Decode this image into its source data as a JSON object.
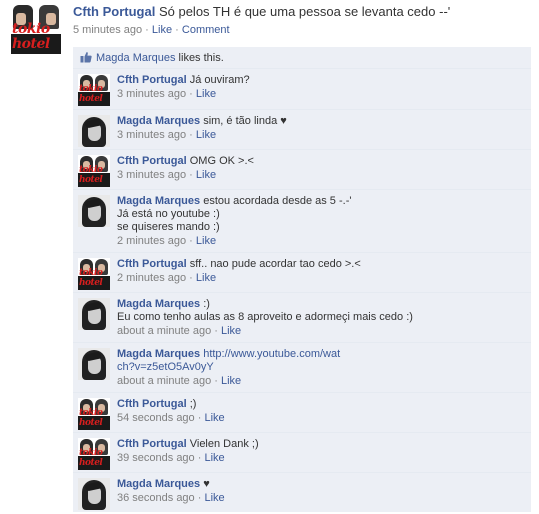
{
  "story": {
    "author": "Cfth Portugal",
    "message": "Só pelos TH é que uma pessoa se levanta cedo --'",
    "time": "5 minutes ago",
    "separator": "·",
    "like_label": "Like",
    "comment_label": "Comment"
  },
  "likes": {
    "name": "Magda Marques",
    "suffix": " likes this."
  },
  "comment_like_label": "Like",
  "separator": "·",
  "avatar_logo_text": "tokio hotel",
  "comments": [
    {
      "author": "Cfth Portugal",
      "avatar": "cfth",
      "lines": [
        "Já ouviram?"
      ],
      "time": "3 minutes ago"
    },
    {
      "author": "Magda Marques",
      "avatar": "magda",
      "lines": [
        "sim, é tão linda ♥"
      ],
      "time": "3 minutes ago"
    },
    {
      "author": "Cfth Portugal",
      "avatar": "cfth",
      "lines": [
        "OMG OK >.<"
      ],
      "time": "3 minutes ago"
    },
    {
      "author": "Magda Marques",
      "avatar": "magda",
      "lines": [
        "estou acordada desde as 5 -.-'",
        "Já está no youtube :)",
        "se quiseres mando :)"
      ],
      "time": "2 minutes ago"
    },
    {
      "author": "Cfth Portugal",
      "avatar": "cfth",
      "lines": [
        "sff.. nao pude acordar tao cedo >.<"
      ],
      "time": "2 minutes ago"
    },
    {
      "author": "Magda Marques",
      "avatar": "magda",
      "lines": [
        ":)",
        "Eu como tenho aulas as 8 aproveito e adormeçi mais cedo :)"
      ],
      "time": "about a minute ago"
    },
    {
      "author": "Magda Marques",
      "avatar": "magda",
      "link": "http://www.youtube.com/watch?v=z5etO5Av0yY",
      "link_lines": [
        "http://www.youtube.com/wat",
        "ch?v=z5etO5Av0yY"
      ],
      "lines": [],
      "time": "about a minute ago"
    },
    {
      "author": "Cfth Portugal",
      "avatar": "cfth",
      "lines": [
        ";)"
      ],
      "time": "54 seconds ago"
    },
    {
      "author": "Cfth Portugal",
      "avatar": "cfth",
      "lines": [
        "Vielen Dank ;)"
      ],
      "time": "39 seconds ago"
    },
    {
      "author": "Magda Marques",
      "avatar": "magda",
      "lines": [
        "♥"
      ],
      "time": "36 seconds ago"
    }
  ],
  "colors": {
    "link": "#3b5998",
    "meta": "#808080",
    "comment_bg": "#eceff5",
    "divider": "#e5eaf1"
  },
  "icons": {
    "like": "thumbs-up-icon"
  }
}
